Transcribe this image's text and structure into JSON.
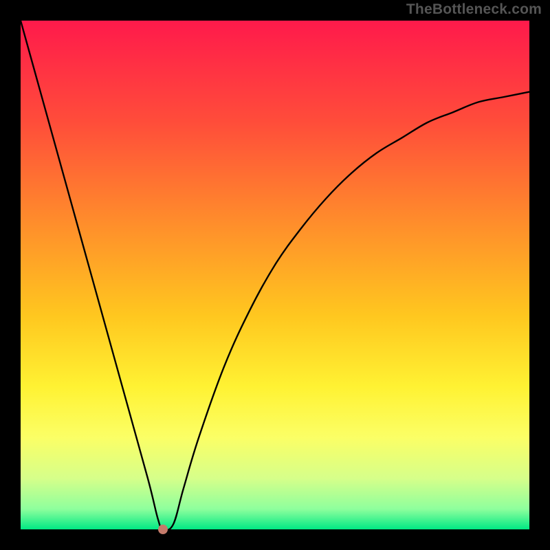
{
  "watermark": "TheBottleneck.com",
  "chart_data": {
    "type": "line",
    "title": "",
    "xlabel": "",
    "ylabel": "",
    "xlim": [
      0,
      100
    ],
    "ylim": [
      0,
      100
    ],
    "grid": false,
    "legend": false,
    "series": [
      {
        "name": "bottleneck-curve",
        "x": [
          0,
          5,
          10,
          15,
          20,
          25,
          27,
          28,
          30,
          32,
          35,
          40,
          45,
          50,
          55,
          60,
          65,
          70,
          75,
          80,
          85,
          90,
          95,
          100
        ],
        "values": [
          100,
          82,
          64,
          46,
          28,
          10,
          2,
          0,
          1,
          8,
          18,
          32,
          43,
          52,
          59,
          65,
          70,
          74,
          77,
          80,
          82,
          84,
          85,
          86
        ]
      }
    ],
    "marker": {
      "x": 28,
      "y": 0,
      "color": "#c47a6a"
    },
    "background_gradient_stops": [
      {
        "offset": 0.0,
        "color": "#ff1a4b"
      },
      {
        "offset": 0.2,
        "color": "#ff4d3a"
      },
      {
        "offset": 0.4,
        "color": "#ff8e2b"
      },
      {
        "offset": 0.58,
        "color": "#ffc71f"
      },
      {
        "offset": 0.72,
        "color": "#fff233"
      },
      {
        "offset": 0.82,
        "color": "#fbff66"
      },
      {
        "offset": 0.9,
        "color": "#d6ff8a"
      },
      {
        "offset": 0.96,
        "color": "#8EFF9D"
      },
      {
        "offset": 1.0,
        "color": "#00e884"
      }
    ],
    "curve_color": "#000000",
    "curve_width": 2.4
  }
}
